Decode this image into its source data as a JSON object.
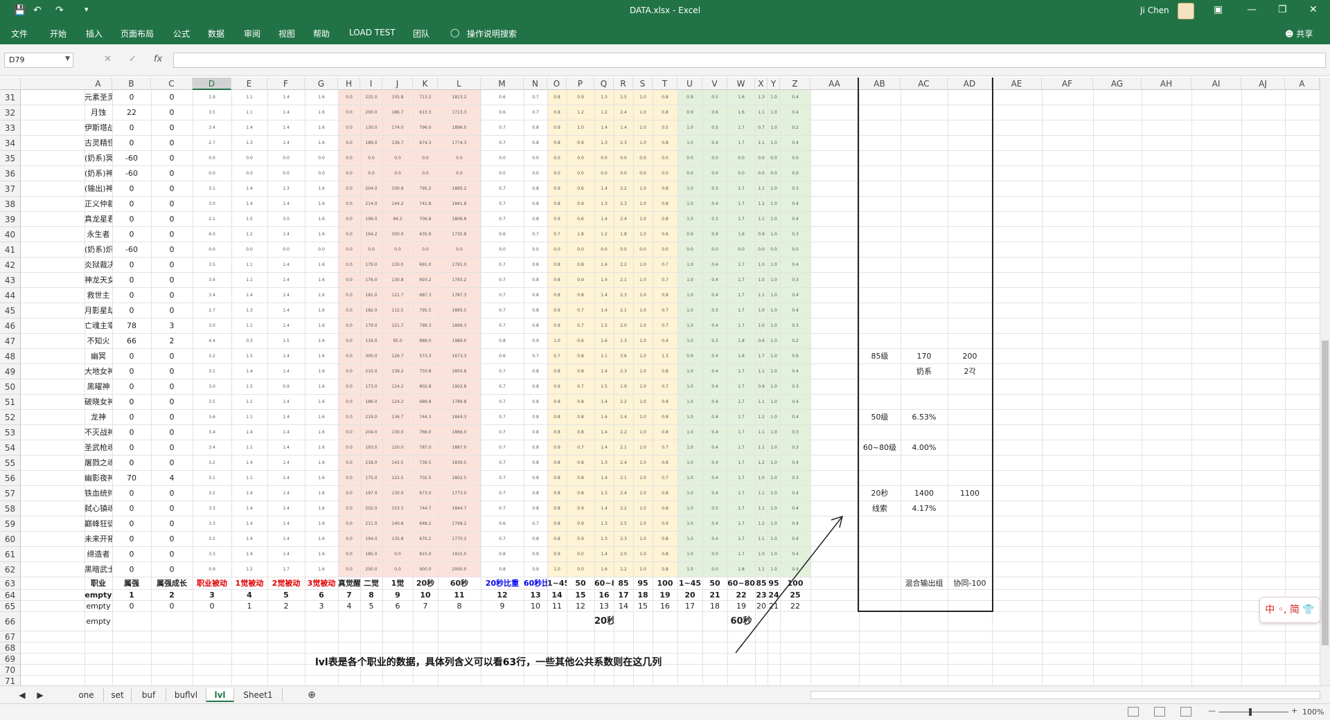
{
  "window": {
    "title": "DATA.xlsx  -  Excel",
    "user": "Ji Chen"
  },
  "qat": {
    "save_icon": "save-icon",
    "undo_icon": "undo-icon",
    "redo_icon": "redo-icon",
    "customize_icon": "customize-icon"
  },
  "ribbon_tabs": [
    "文件",
    "开始",
    "插入",
    "页面布局",
    "公式",
    "数据",
    "审阅",
    "视图",
    "帮助",
    "LOAD TEST",
    "团队"
  ],
  "tell_me": "操作说明搜索",
  "share": "共享",
  "namebox": "D79",
  "columns": [
    "A",
    "B",
    "C",
    "D",
    "E",
    "F",
    "G",
    "H",
    "I",
    "J",
    "K",
    "L",
    "M",
    "N",
    "O",
    "P",
    "Q",
    "R",
    "S",
    "T",
    "U",
    "V",
    "W",
    "X",
    "Y",
    "Z",
    "AA",
    "AB",
    "AC",
    "AD",
    "AE",
    "AF",
    "AG",
    "AH",
    "AI",
    "AJ",
    "A"
  ],
  "row_numbers": [
    "31",
    "32",
    "33",
    "34",
    "35",
    "36",
    "37",
    "38",
    "39",
    "40",
    "41",
    "42",
    "43",
    "44",
    "45",
    "46",
    "47",
    "48",
    "49",
    "50",
    "51",
    "52",
    "53",
    "54",
    "55",
    "56",
    "57",
    "58",
    "59",
    "60",
    "61",
    "62",
    "63",
    "64",
    "65",
    "66",
    "67",
    "68",
    "69",
    "70",
    "71"
  ],
  "data_rows": [
    {
      "name": "元素圣灵",
      "b": "0",
      "c": "0",
      "d": "1.9",
      "e": "1.1",
      "f": "1.4",
      "g": "1.6",
      "h": "0.0",
      "i": "231.0",
      "j": "155.8",
      "k": "713.2",
      "l": "1813.2",
      "m": "0.6",
      "n": "0.7",
      "o": "0.8",
      "p": "0.9",
      "q": "1.3",
      "r": "2.5",
      "s": "1.0",
      "t": "0.8",
      "u": "0.9",
      "v": "0.5",
      "w": "1.6",
      "x": "1.3",
      "y": "1.0",
      "z": "0.4"
    },
    {
      "name": "月蚀",
      "b": "22",
      "c": "0",
      "d": "3.5",
      "e": "1.1",
      "f": "1.4",
      "g": "1.6",
      "h": "0.0",
      "i": "200.0",
      "j": "186.7",
      "k": "613.3",
      "l": "1713.3",
      "m": "0.6",
      "n": "0.7",
      "o": "0.8",
      "p": "1.2",
      "q": "1.2",
      "r": "2.4",
      "s": "1.0",
      "t": "0.8",
      "u": "0.9",
      "v": "0.6",
      "w": "1.6",
      "x": "1.1",
      "y": "1.0",
      "z": "0.4"
    },
    {
      "name": "伊斯塔战灵",
      "b": "0",
      "c": "0",
      "d": "3.4",
      "e": "1.4",
      "f": "1.4",
      "g": "1.6",
      "h": "0.0",
      "i": "130.0",
      "j": "174.0",
      "k": "796.0",
      "l": "1896.0",
      "m": "0.7",
      "n": "0.8",
      "o": "0.9",
      "p": "1.0",
      "q": "1.4",
      "r": "1.4",
      "s": "1.0",
      "t": "0.5",
      "u": "1.0",
      "v": "0.5",
      "w": "1.7",
      "x": "0.7",
      "y": "1.0",
      "z": "0.2"
    },
    {
      "name": "古灵精怪",
      "b": "0",
      "c": "0",
      "d": "2.7",
      "e": "1.3",
      "f": "1.4",
      "g": "1.6",
      "h": "0.0",
      "i": "189.0",
      "j": "136.7",
      "k": "674.3",
      "l": "1774.3",
      "m": "0.7",
      "n": "0.8",
      "o": "0.8",
      "p": "0.9",
      "q": "1.3",
      "r": "2.3",
      "s": "1.0",
      "t": "0.8",
      "u": "1.0",
      "v": "0.4",
      "w": "1.7",
      "x": "1.1",
      "y": "1.0",
      "z": "0.4"
    },
    {
      "name": "(奶系)冥月女神",
      "b": "-60",
      "c": "0",
      "d": "0.0",
      "e": "0.0",
      "f": "0.0",
      "g": "0.0",
      "h": "0.0",
      "i": "0.0",
      "j": "0.0",
      "k": "0.0",
      "l": "0.0",
      "m": "0.0",
      "n": "0.0",
      "o": "0.0",
      "p": "0.0",
      "q": "0.0",
      "r": "0.0",
      "s": "0.0",
      "t": "0.0",
      "u": "0.0",
      "v": "0.0",
      "w": "0.0",
      "x": "0.0",
      "y": "0.0",
      "z": "0.0"
    },
    {
      "name": "(奶系)神思者",
      "b": "-60",
      "c": "0",
      "d": "0.0",
      "e": "0.0",
      "f": "0.0",
      "g": "0.0",
      "h": "0.0",
      "i": "0.0",
      "j": "0.0",
      "k": "0.0",
      "l": "0.0",
      "m": "0.0",
      "n": "0.0",
      "o": "0.0",
      "p": "0.0",
      "q": "0.0",
      "r": "0.0",
      "s": "0.0",
      "t": "0.0",
      "u": "0.0",
      "v": "0.0",
      "w": "0.0",
      "x": "0.0",
      "y": "0.0",
      "z": "0.0"
    },
    {
      "name": "(输出)神思者",
      "b": "0",
      "c": "0",
      "d": "3.1",
      "e": "1.4",
      "f": "1.3",
      "g": "1.6",
      "h": "0.0",
      "i": "204.0",
      "j": "100.8",
      "k": "795.2",
      "l": "1895.2",
      "m": "0.7",
      "n": "0.8",
      "o": "0.9",
      "p": "0.6",
      "q": "1.4",
      "r": "2.2",
      "s": "1.0",
      "t": "0.8",
      "u": "1.0",
      "v": "0.3",
      "w": "1.7",
      "x": "1.1",
      "y": "1.0",
      "z": "0.3"
    },
    {
      "name": "正义仲裁者",
      "b": "0",
      "c": "0",
      "d": "3.0",
      "e": "1.4",
      "f": "1.4",
      "g": "1.6",
      "h": "0.0",
      "i": "214.0",
      "j": "144.2",
      "k": "741.8",
      "l": "1841.8",
      "m": "0.7",
      "n": "0.8",
      "o": "0.8",
      "p": "0.9",
      "q": "1.3",
      "r": "2.3",
      "s": "1.0",
      "t": "0.8",
      "u": "1.0",
      "v": "0.4",
      "w": "1.7",
      "x": "1.2",
      "y": "1.0",
      "z": "0.4"
    },
    {
      "name": "真龙星君",
      "b": "0",
      "c": "0",
      "d": "2.1",
      "e": "1.5",
      "f": "3.0",
      "g": "1.6",
      "h": "0.0",
      "i": "199.0",
      "j": "94.2",
      "k": "706.8",
      "l": "1806.8",
      "m": "0.7",
      "n": "0.8",
      "o": "0.9",
      "p": "0.6",
      "q": "1.4",
      "r": "2.4",
      "s": "1.0",
      "t": "0.8",
      "u": "1.0",
      "v": "0.3",
      "w": "1.7",
      "x": "1.1",
      "y": "1.0",
      "z": "0.4"
    },
    {
      "name": "永生者",
      "b": "0",
      "c": "0",
      "d": "4.0",
      "e": "1.2",
      "f": "1.4",
      "g": "1.6",
      "h": "0.0",
      "i": "164.2",
      "j": "300.0",
      "k": "635.8",
      "l": "1735.8",
      "m": "0.6",
      "n": "0.7",
      "o": "0.7",
      "p": "1.8",
      "q": "1.2",
      "r": "1.8",
      "s": "1.0",
      "t": "0.6",
      "u": "0.9",
      "v": "0.9",
      "w": "1.6",
      "x": "0.9",
      "y": "1.0",
      "z": "0.3"
    },
    {
      "name": "(奶系)炽天使",
      "b": "-60",
      "c": "0",
      "d": "0.0",
      "e": "0.0",
      "f": "0.0",
      "g": "0.0",
      "h": "0.0",
      "i": "0.0",
      "j": "0.0",
      "k": "0.0",
      "l": "0.0",
      "m": "0.0",
      "n": "0.0",
      "o": "0.0",
      "p": "0.0",
      "q": "0.0",
      "r": "0.0",
      "s": "0.0",
      "t": "0.0",
      "u": "0.0",
      "v": "0.0",
      "w": "0.0",
      "x": "0.0",
      "y": "0.0",
      "z": "0.0"
    },
    {
      "name": "炎狱裁决者",
      "b": "0",
      "c": "0",
      "d": "3.5",
      "e": "1.1",
      "f": "1.4",
      "g": "1.6",
      "h": "0.0",
      "i": "179.0",
      "j": "130.0",
      "k": "691.0",
      "l": "1791.0",
      "m": "0.7",
      "n": "0.8",
      "o": "0.8",
      "p": "0.8",
      "q": "1.4",
      "r": "2.2",
      "s": "1.0",
      "t": "0.7",
      "u": "1.0",
      "v": "0.4",
      "w": "1.7",
      "x": "1.0",
      "y": "1.0",
      "z": "0.4"
    },
    {
      "name": "神龙天女",
      "b": "0",
      "c": "0",
      "d": "3.4",
      "e": "1.1",
      "f": "1.4",
      "g": "1.6",
      "h": "0.0",
      "i": "176.0",
      "j": "130.8",
      "k": "693.2",
      "l": "1793.2",
      "m": "0.7",
      "n": "0.8",
      "o": "0.8",
      "p": "0.9",
      "q": "1.4",
      "r": "2.1",
      "s": "1.0",
      "t": "0.7",
      "u": "1.0",
      "v": "0.4",
      "w": "1.7",
      "x": "1.0",
      "y": "1.0",
      "z": "0.3"
    },
    {
      "name": "救世主",
      "b": "0",
      "c": "0",
      "d": "3.4",
      "e": "1.4",
      "f": "1.4",
      "g": "1.6",
      "h": "0.0",
      "i": "181.0",
      "j": "121.7",
      "k": "687.3",
      "l": "1787.3",
      "m": "0.7",
      "n": "0.8",
      "o": "0.8",
      "p": "0.8",
      "q": "1.4",
      "r": "2.3",
      "s": "1.0",
      "t": "0.8",
      "u": "1.0",
      "v": "0.4",
      "w": "1.7",
      "x": "1.1",
      "y": "1.0",
      "z": "0.4"
    },
    {
      "name": "月影星劫",
      "b": "0",
      "c": "0",
      "d": "2.7",
      "e": "1.3",
      "f": "1.4",
      "g": "1.6",
      "h": "0.0",
      "i": "182.0",
      "j": "112.5",
      "k": "795.5",
      "l": "1895.5",
      "m": "0.7",
      "n": "0.8",
      "o": "0.9",
      "p": "0.7",
      "q": "1.4",
      "r": "2.1",
      "s": "1.0",
      "t": "0.7",
      "u": "1.0",
      "v": "0.3",
      "w": "1.7",
      "x": "1.0",
      "y": "1.0",
      "z": "0.4"
    },
    {
      "name": "亡魂主宰",
      "b": "78",
      "c": "3",
      "d": "3.0",
      "e": "1.1",
      "f": "1.4",
      "g": "1.6",
      "h": "0.0",
      "i": "179.0",
      "j": "121.7",
      "k": "799.3",
      "l": "1899.3",
      "m": "0.7",
      "n": "0.8",
      "o": "0.9",
      "p": "0.7",
      "q": "1.5",
      "r": "2.0",
      "s": "1.0",
      "t": "0.7",
      "u": "1.0",
      "v": "0.4",
      "w": "1.7",
      "x": "1.0",
      "y": "1.0",
      "z": "0.3"
    },
    {
      "name": "不知火",
      "b": "66",
      "c": "2",
      "d": "4.4",
      "e": "0.3",
      "f": "1.5",
      "g": "1.6",
      "h": "0.0",
      "i": "116.0",
      "j": "95.0",
      "k": "889.0",
      "l": "1989.0",
      "m": "0.8",
      "n": "0.9",
      "o": "1.0",
      "p": "0.6",
      "q": "1.6",
      "r": "1.3",
      "s": "1.0",
      "t": "0.4",
      "u": "1.0",
      "v": "0.3",
      "w": "1.8",
      "x": "0.6",
      "y": "1.0",
      "z": "0.2"
    },
    {
      "name": "幽冥",
      "b": "0",
      "c": "0",
      "d": "3.2",
      "e": "1.5",
      "f": "1.4",
      "g": "1.6",
      "h": "0.0",
      "i": "300.0",
      "j": "126.7",
      "k": "573.3",
      "l": "1673.3",
      "m": "0.6",
      "n": "0.7",
      "o": "0.7",
      "p": "0.8",
      "q": "1.1",
      "r": "3.6",
      "s": "1.0",
      "t": "1.3",
      "u": "0.9",
      "v": "0.4",
      "w": "1.6",
      "x": "1.7",
      "y": "1.0",
      "z": "0.6"
    },
    {
      "name": "大地女神",
      "b": "0",
      "c": "0",
      "d": "3.1",
      "e": "1.4",
      "f": "1.4",
      "g": "1.6",
      "h": "0.0",
      "i": "210.0",
      "j": "139.2",
      "k": "750.8",
      "l": "1850.8",
      "m": "0.7",
      "n": "0.8",
      "o": "0.8",
      "p": "0.8",
      "q": "1.4",
      "r": "2.3",
      "s": "1.0",
      "t": "0.8",
      "u": "1.0",
      "v": "0.4",
      "w": "1.7",
      "x": "1.1",
      "y": "1.0",
      "z": "0.4"
    },
    {
      "name": "黑曜神",
      "b": "0",
      "c": "0",
      "d": "3.0",
      "e": "1.5",
      "f": "0.9",
      "g": "1.6",
      "h": "0.0",
      "i": "173.0",
      "j": "124.2",
      "k": "802.8",
      "l": "1902.8",
      "m": "0.7",
      "n": "0.8",
      "o": "0.9",
      "p": "0.7",
      "q": "1.5",
      "r": "1.9",
      "s": "1.0",
      "t": "0.7",
      "u": "1.0",
      "v": "0.4",
      "w": "1.7",
      "x": "0.9",
      "y": "1.0",
      "z": "0.3"
    },
    {
      "name": "破晓女神",
      "b": "0",
      "c": "0",
      "d": "3.5",
      "e": "1.1",
      "f": "1.4",
      "g": "1.6",
      "h": "0.0",
      "i": "186.0",
      "j": "124.2",
      "k": "689.8",
      "l": "1789.8",
      "m": "0.7",
      "n": "0.8",
      "o": "0.8",
      "p": "0.8",
      "q": "1.4",
      "r": "2.2",
      "s": "1.0",
      "t": "0.8",
      "u": "1.0",
      "v": "0.4",
      "w": "1.7",
      "x": "1.1",
      "y": "1.0",
      "z": "0.4"
    },
    {
      "name": "龙神",
      "b": "0",
      "c": "0",
      "d": "3.6",
      "e": "1.1",
      "f": "1.4",
      "g": "1.6",
      "h": "0.0",
      "i": "219.0",
      "j": "136.7",
      "k": "744.3",
      "l": "1844.3",
      "m": "0.7",
      "n": "0.8",
      "o": "0.8",
      "p": "0.8",
      "q": "1.4",
      "r": "2.4",
      "s": "1.0",
      "t": "0.8",
      "u": "1.0",
      "v": "0.4",
      "w": "1.7",
      "x": "1.2",
      "y": "1.0",
      "z": "0.4"
    },
    {
      "name": "不灭战神",
      "b": "0",
      "c": "0",
      "d": "3.4",
      "e": "1.4",
      "f": "1.4",
      "g": "1.6",
      "h": "0.0",
      "i": "204.0",
      "j": "130.0",
      "k": "766.0",
      "l": "1866.0",
      "m": "0.7",
      "n": "0.8",
      "o": "0.8",
      "p": "0.8",
      "q": "1.4",
      "r": "2.2",
      "s": "1.0",
      "t": "0.8",
      "u": "1.0",
      "v": "0.4",
      "w": "1.7",
      "x": "1.1",
      "y": "1.0",
      "z": "0.3"
    },
    {
      "name": "圣武枪魂",
      "b": "0",
      "c": "0",
      "d": "3.4",
      "e": "1.1",
      "f": "1.4",
      "g": "1.6",
      "h": "0.0",
      "i": "193.0",
      "j": "120.0",
      "k": "787.0",
      "l": "1887.0",
      "m": "0.7",
      "n": "0.8",
      "o": "0.9",
      "p": "0.7",
      "q": "1.4",
      "r": "2.1",
      "s": "1.0",
      "t": "0.7",
      "u": "1.0",
      "v": "0.4",
      "w": "1.7",
      "x": "1.1",
      "y": "1.0",
      "z": "0.3"
    },
    {
      "name": "屠戮之魂",
      "b": "0",
      "c": "0",
      "d": "3.2",
      "e": "1.4",
      "f": "1.4",
      "g": "1.6",
      "h": "0.0",
      "i": "218.0",
      "j": "142.5",
      "k": "739.5",
      "l": "1839.5",
      "m": "0.7",
      "n": "0.8",
      "o": "0.8",
      "p": "0.8",
      "q": "1.3",
      "r": "2.4",
      "s": "1.0",
      "t": "0.8",
      "u": "1.0",
      "v": "0.4",
      "w": "1.7",
      "x": "1.2",
      "y": "1.0",
      "z": "0.4"
    },
    {
      "name": "幽影夜神",
      "b": "70",
      "c": "4",
      "d": "3.1",
      "e": "1.1",
      "f": "1.4",
      "g": "1.6",
      "h": "0.0",
      "i": "175.0",
      "j": "122.5",
      "k": "702.5",
      "l": "1802.5",
      "m": "0.7",
      "n": "0.8",
      "o": "0.8",
      "p": "0.8",
      "q": "1.4",
      "r": "2.1",
      "s": "1.0",
      "t": "0.7",
      "u": "1.0",
      "v": "0.4",
      "w": "1.7",
      "x": "1.0",
      "y": "1.0",
      "z": "0.3"
    },
    {
      "name": "铁血统帅",
      "b": "0",
      "c": "0",
      "d": "3.2",
      "e": "1.4",
      "f": "1.4",
      "g": "1.6",
      "h": "0.0",
      "i": "197.0",
      "j": "130.0",
      "k": "673.0",
      "l": "1773.0",
      "m": "0.7",
      "n": "0.8",
      "o": "0.8",
      "p": "0.8",
      "q": "1.3",
      "r": "2.4",
      "s": "1.0",
      "t": "0.8",
      "u": "1.0",
      "v": "0.4",
      "w": "1.7",
      "x": "1.1",
      "y": "1.0",
      "z": "0.4"
    },
    {
      "name": "弑心镇魂者",
      "b": "0",
      "c": "0",
      "d": "3.3",
      "e": "1.4",
      "f": "1.4",
      "g": "1.6",
      "h": "0.0",
      "i": "202.0",
      "j": "153.3",
      "k": "744.7",
      "l": "1844.7",
      "m": "0.7",
      "n": "0.8",
      "o": "0.8",
      "p": "0.9",
      "q": "1.4",
      "r": "2.2",
      "s": "1.0",
      "t": "0.8",
      "u": "1.0",
      "v": "0.5",
      "w": "1.7",
      "x": "1.1",
      "y": "1.0",
      "z": "0.4"
    },
    {
      "name": "巅峰狂徒",
      "b": "0",
      "c": "0",
      "d": "3.3",
      "e": "1.4",
      "f": "1.4",
      "g": "1.6",
      "h": "0.0",
      "i": "211.0",
      "j": "140.8",
      "k": "648.2",
      "l": "1748.2",
      "m": "0.6",
      "n": "0.7",
      "o": "0.8",
      "p": "0.9",
      "q": "1.3",
      "r": "2.5",
      "s": "1.0",
      "t": "0.9",
      "u": "1.0",
      "v": "0.4",
      "w": "1.7",
      "x": "1.2",
      "y": "1.0",
      "z": "0.4"
    },
    {
      "name": "未来开拓者",
      "b": "0",
      "c": "0",
      "d": "3.2",
      "e": "1.4",
      "f": "1.4",
      "g": "1.6",
      "h": "0.0",
      "i": "194.0",
      "j": "135.8",
      "k": "670.2",
      "l": "1770.2",
      "m": "0.7",
      "n": "0.8",
      "o": "0.8",
      "p": "0.9",
      "q": "1.3",
      "r": "2.3",
      "s": "1.0",
      "t": "0.8",
      "u": "1.0",
      "v": "0.4",
      "w": "1.7",
      "x": "1.1",
      "y": "1.0",
      "z": "0.4"
    },
    {
      "name": "缔造者",
      "b": "0",
      "c": "0",
      "d": "3.3",
      "e": "1.4",
      "f": "1.4",
      "g": "1.6",
      "h": "0.0",
      "i": "185.0",
      "j": "0.0",
      "k": "815.0",
      "l": "1915.0",
      "m": "0.8",
      "n": "0.9",
      "o": "0.9",
      "p": "0.0",
      "q": "1.4",
      "r": "2.0",
      "s": "1.0",
      "t": "0.8",
      "u": "1.0",
      "v": "0.0",
      "w": "1.7",
      "x": "1.0",
      "y": "1.0",
      "z": "0.4"
    },
    {
      "name": "黑暗武士",
      "b": "0",
      "c": "0",
      "d": "0.9",
      "e": "1.2",
      "f": "1.7",
      "g": "1.6",
      "h": "0.0",
      "i": "200.0",
      "j": "0.0",
      "k": "900.0",
      "l": "2000.0",
      "m": "0.8",
      "n": "0.9",
      "o": "1.0",
      "p": "0.0",
      "q": "1.6",
      "r": "2.2",
      "s": "1.0",
      "t": "0.8",
      "u": "1.0",
      "v": "0.0",
      "w": "1.8",
      "x": "1.1",
      "y": "1.0",
      "z": "0.4"
    }
  ],
  "row63": [
    "职业",
    "属强",
    "属强成长",
    "职业被动",
    "1觉被动",
    "2觉被动",
    "3觉被动",
    "真觉醒",
    "二觉",
    "1觉",
    "20秒",
    "60秒",
    "20秒比重",
    "60秒比重",
    "1~45",
    "50",
    "60~80",
    "85",
    "95",
    "100",
    "1~45",
    "50",
    "60~80",
    "85",
    "95",
    "100"
  ],
  "row64": [
    "empty",
    "1",
    "2",
    "3",
    "4",
    "5",
    "6",
    "7",
    "8",
    "9",
    "10",
    "11",
    "12",
    "13",
    "14",
    "15",
    "16",
    "17",
    "18",
    "19",
    "20",
    "21",
    "22",
    "23",
    "24",
    "25"
  ],
  "row65": [
    "empty",
    "0",
    "0",
    "0",
    "1",
    "2",
    "3",
    "4",
    "5",
    "6",
    "7",
    "8",
    "9",
    "10",
    "11",
    "12",
    "13",
    "14",
    "15",
    "16",
    "17",
    "18",
    "19",
    "20",
    "21",
    "22"
  ],
  "row66": {
    "a": "empty",
    "q": "20秒",
    "w": "60秒"
  },
  "side": {
    "r48": [
      "85级",
      "170",
      "200"
    ],
    "r49": [
      "奶系",
      "2각"
    ],
    "r52": [
      "50级",
      "6.53%"
    ],
    "r54": [
      "60~80级",
      "4.00%"
    ],
    "r57": [
      "20秒",
      "1400",
      "1100"
    ],
    "r58": [
      "线索",
      "4.17%"
    ],
    "r63": [
      "混合输出组",
      "协同-100"
    ]
  },
  "note": "lvl表是各个职业的数据，具体列含义可以看63行，一些其他公共系数则在这几列",
  "ime_label": "中 ◦, 简 👕",
  "sheets": [
    "one",
    "set",
    "buf",
    "buflvl",
    "lvl",
    "Sheet1"
  ],
  "active_sheet": "lvl",
  "zoom": "100%",
  "colors": {
    "excel_green": "#217346",
    "band_red": "#fbe3dc",
    "band_yellow": "#fdf3d5",
    "band_green": "#e3f1dc"
  }
}
